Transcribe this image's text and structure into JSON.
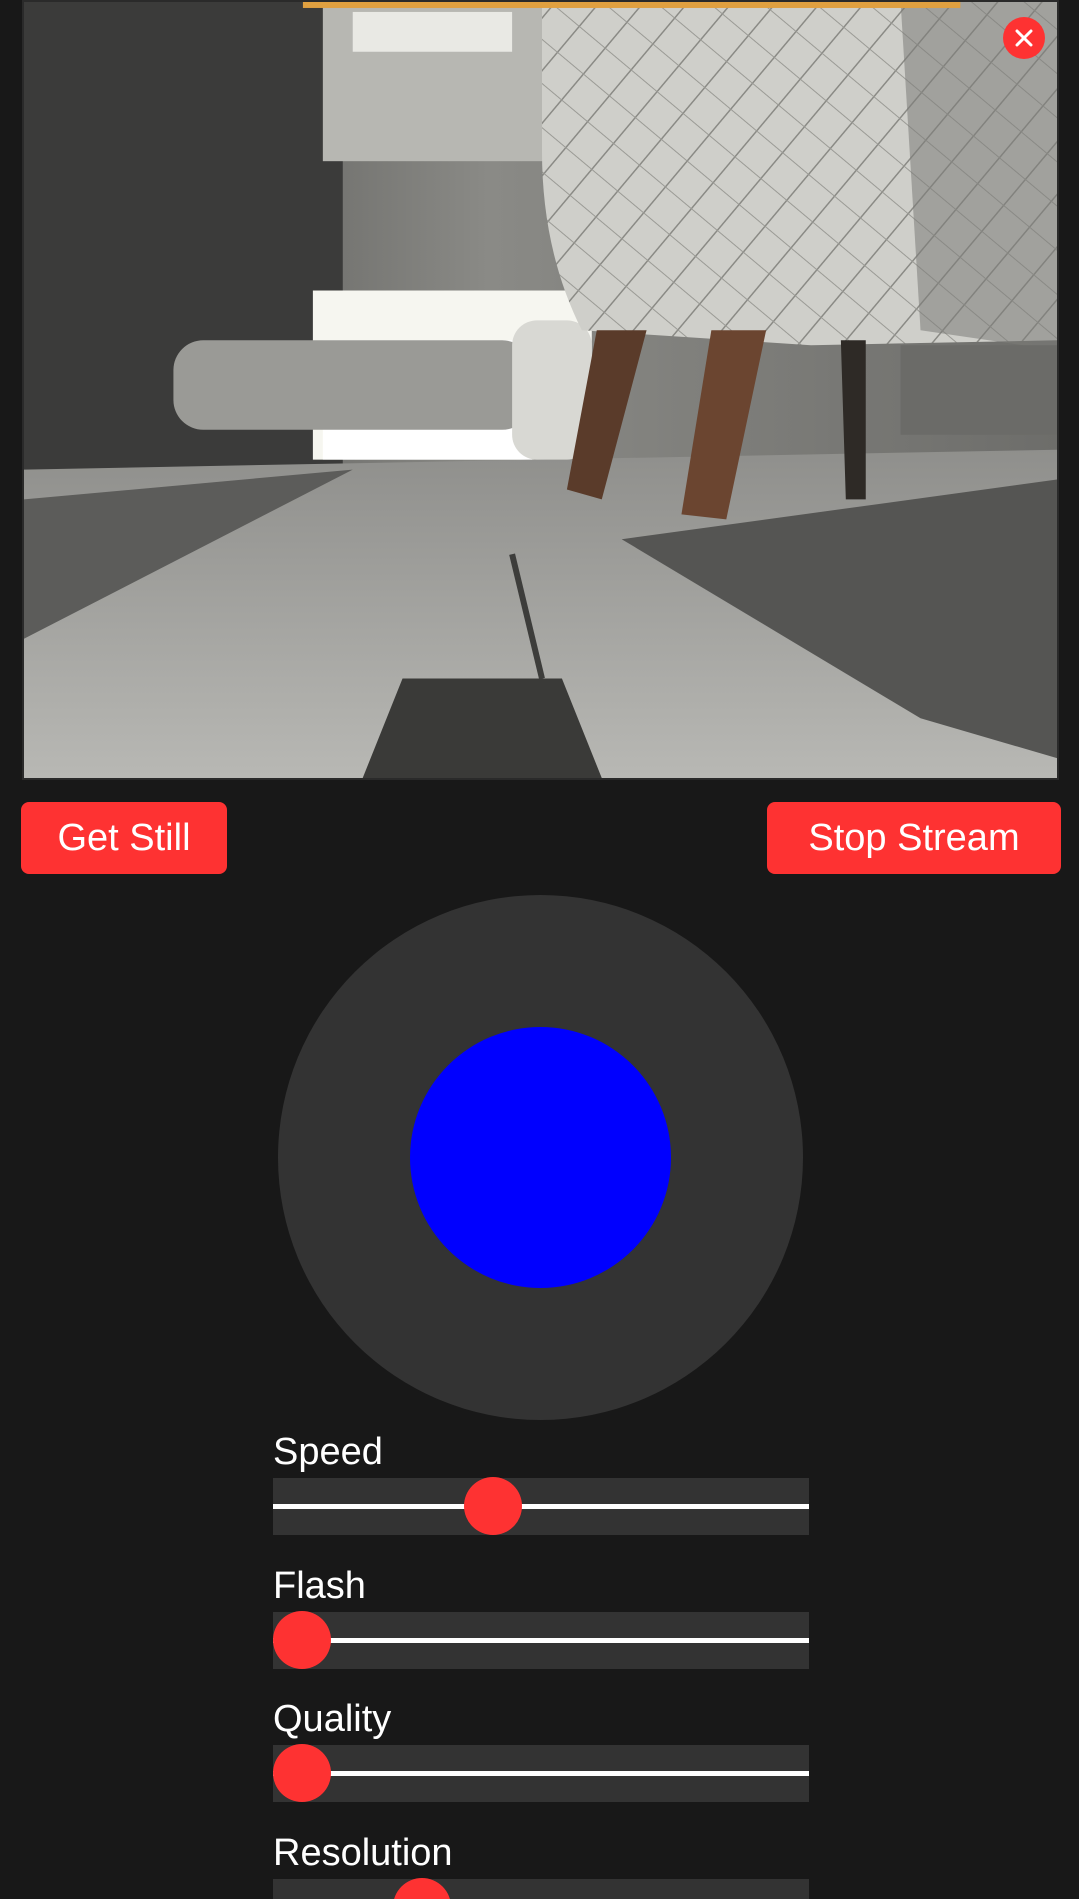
{
  "colors": {
    "background": "#181818",
    "accent": "#fe3232",
    "panel": "#333333",
    "joystick_knob": "#0000ff",
    "text": "#ffffff"
  },
  "stream": {
    "icon": "camera-stream-image",
    "close_icon": "close-icon"
  },
  "buttons": {
    "get_still": "Get Still",
    "stop_stream": "Stop Stream"
  },
  "controls": {
    "speed": {
      "label": "Speed",
      "value_fraction": 0.4
    },
    "flash": {
      "label": "Flash",
      "value_fraction": 0.0
    },
    "quality": {
      "label": "Quality",
      "value_fraction": 0.0
    },
    "resolution": {
      "label": "Resolution",
      "value_fraction": 0.25
    }
  }
}
